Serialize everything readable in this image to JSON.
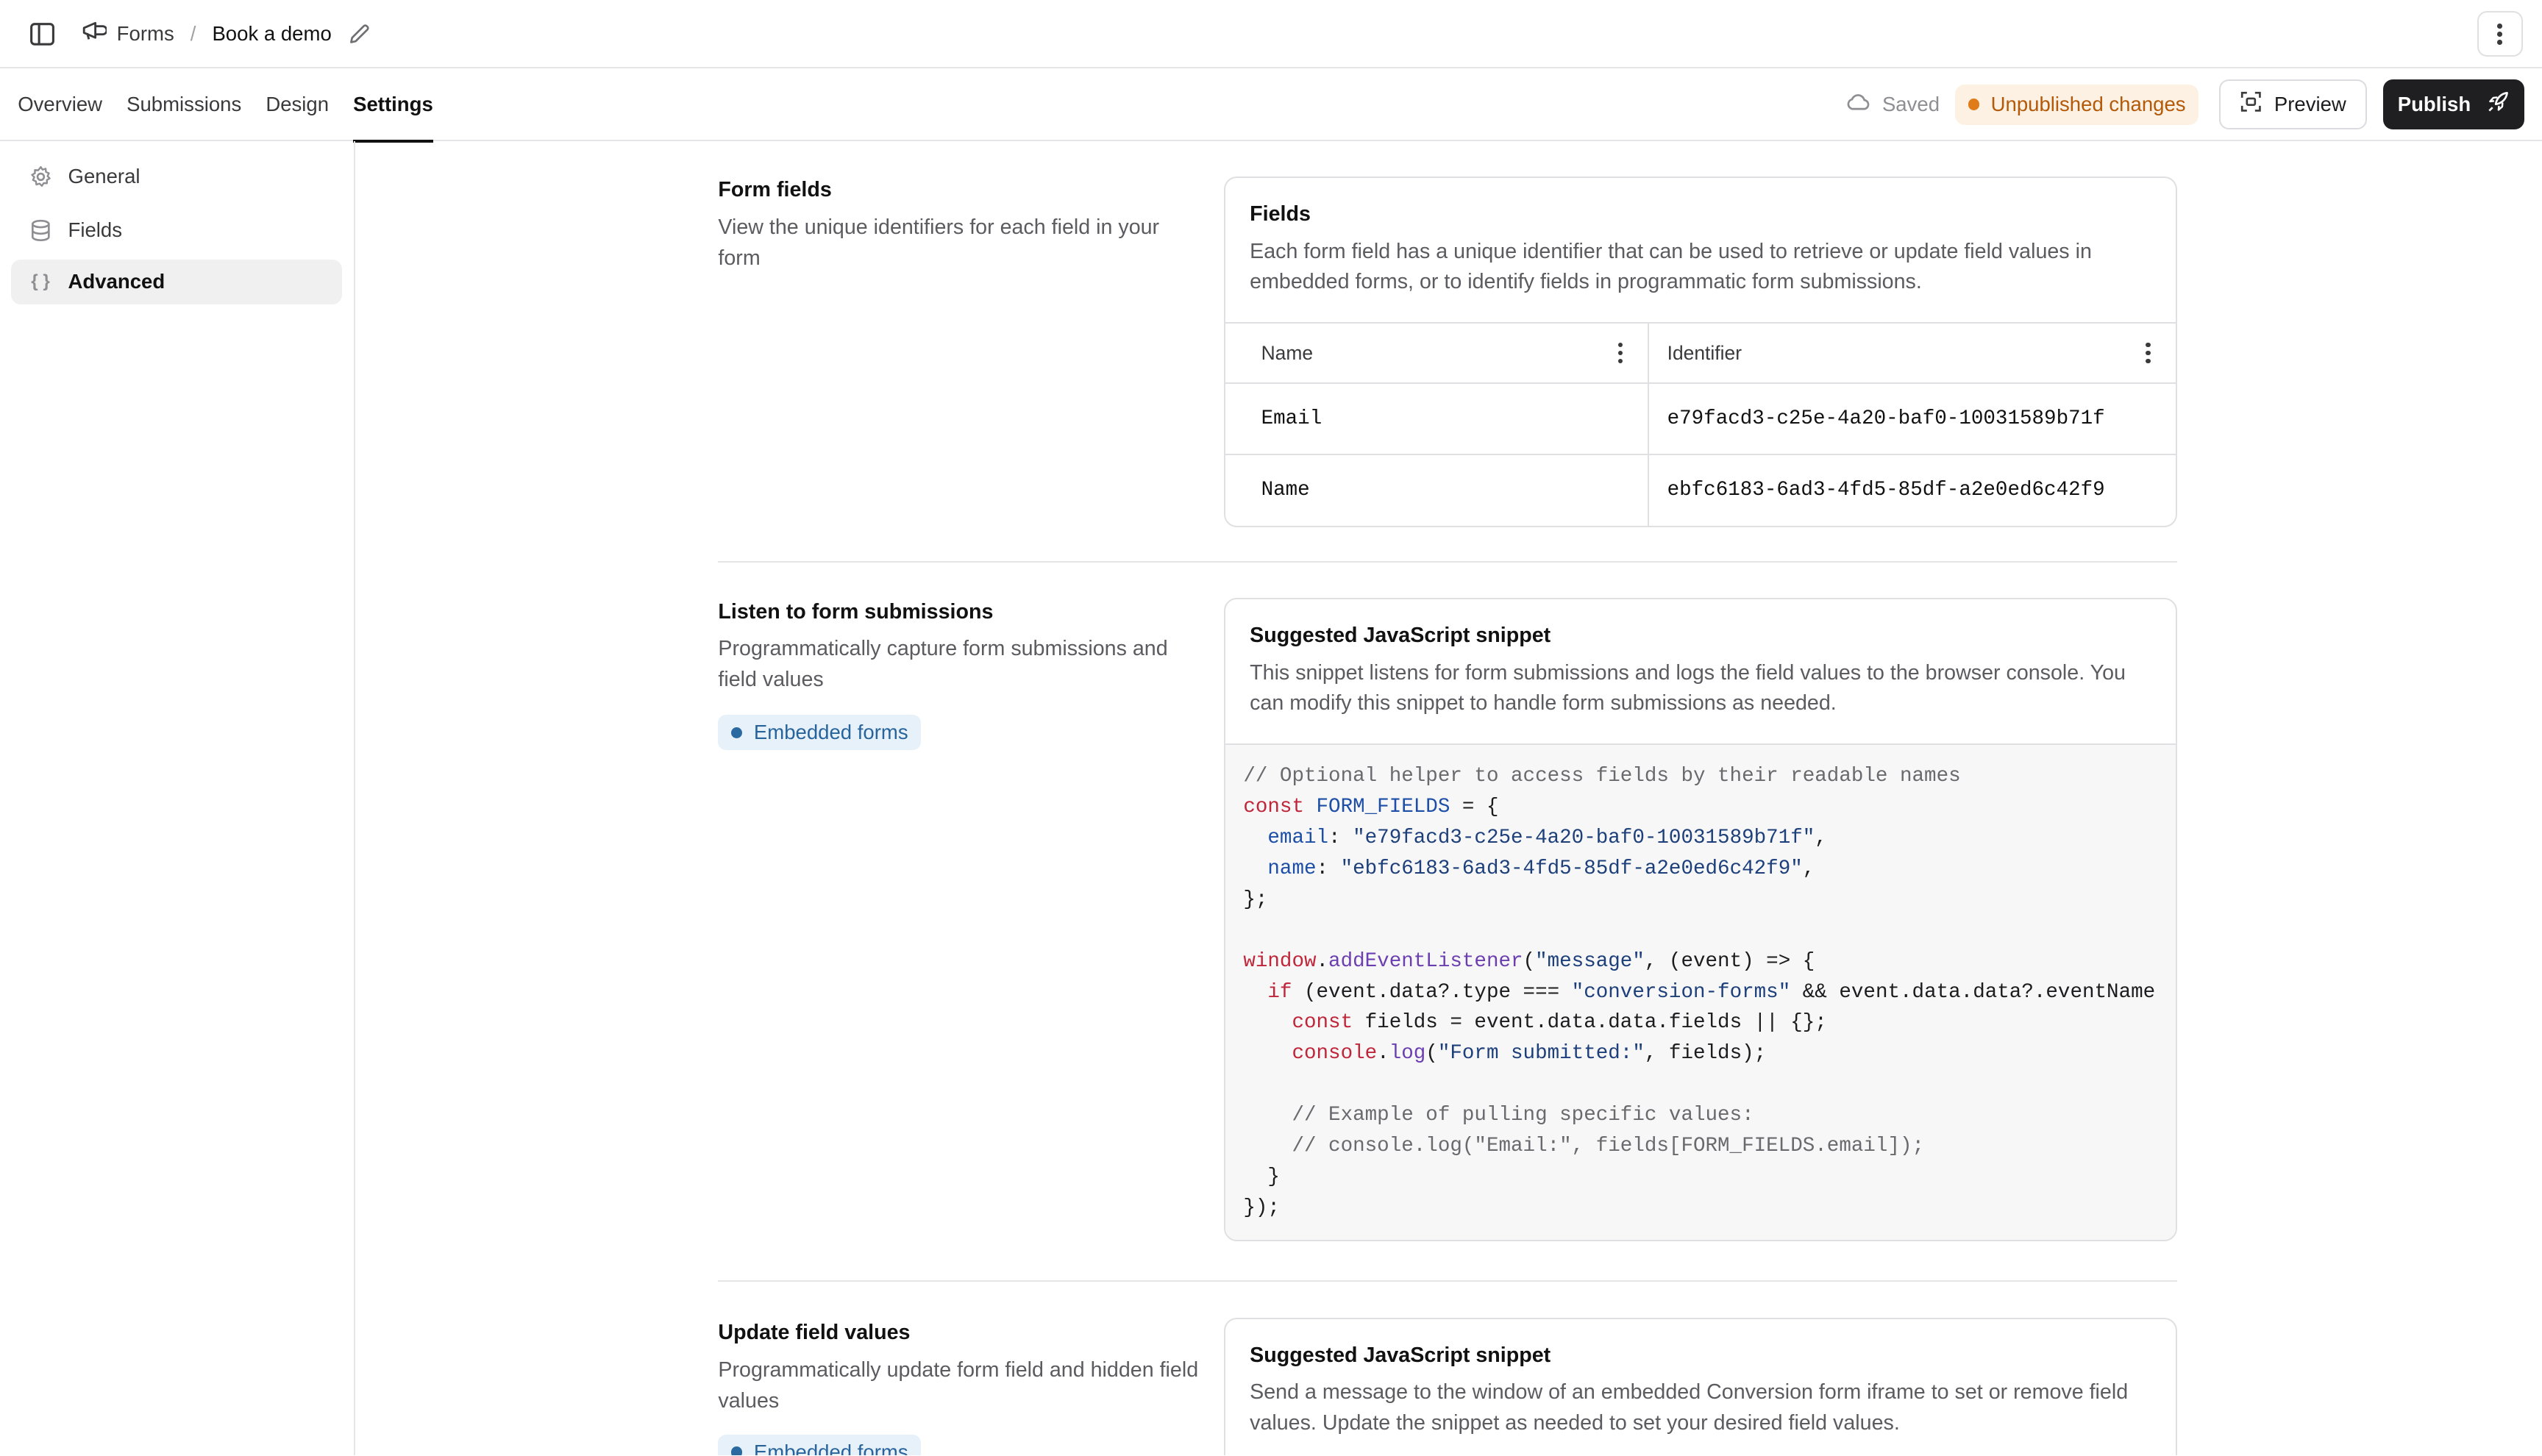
{
  "breadcrumb": {
    "root": "Forms",
    "separator": "/",
    "current": "Book a demo"
  },
  "tabs": [
    {
      "label": "Overview",
      "active": false
    },
    {
      "label": "Submissions",
      "active": false
    },
    {
      "label": "Design",
      "active": false
    },
    {
      "label": "Settings",
      "active": true
    }
  ],
  "status": {
    "saved": "Saved",
    "unpublished": "Unpublished changes"
  },
  "actions": {
    "preview": "Preview",
    "publish": "Publish"
  },
  "sidebar": {
    "items": [
      {
        "label": "General",
        "icon": "gear-icon"
      },
      {
        "label": "Fields",
        "icon": "database-icon"
      },
      {
        "label": "Advanced",
        "icon": "braces-icon",
        "active": true
      }
    ]
  },
  "sections": {
    "form_fields": {
      "title": "Form fields",
      "description": "View the unique identifiers for each field in your form",
      "card_title": "Fields",
      "card_description": "Each form field has a unique identifier that can be used to retrieve or update field values in embedded forms, or to identify fields in programmatic form submissions.",
      "columns": [
        "Name",
        "Identifier"
      ],
      "rows": [
        {
          "name": "Email",
          "identifier": "e79facd3-c25e-4a20-baf0-10031589b71f"
        },
        {
          "name": "Name",
          "identifier": "ebfc6183-6ad3-4fd5-85df-a2e0ed6c42f9"
        }
      ]
    },
    "listen": {
      "title": "Listen to form submissions",
      "description": "Programmatically capture form submissions and field values",
      "tag": "Embedded forms",
      "card_title": "Suggested JavaScript snippet",
      "card_description": "This snippet listens for form submissions and logs the field values to the browser console. You can modify this snippet to handle form submissions as needed.",
      "code": [
        "// Optional helper to access fields by their readable names",
        "const FORM_FIELDS = {",
        "  email: \"e79facd3-c25e-4a20-baf0-10031589b71f\",",
        "  name: \"ebfc6183-6ad3-4fd5-85df-a2e0ed6c42f9\",",
        "};",
        "",
        "window.addEventListener(\"message\", (event) => {",
        "  if (event.data?.type === \"conversion-forms\" && event.data.data?.eventName",
        "    const fields = event.data.data.fields || {};",
        "    console.log(\"Form submitted:\", fields);",
        "",
        "    // Example of pulling specific values:",
        "    // console.log(\"Email:\", fields[FORM_FIELDS.email]);",
        "  }",
        "});"
      ]
    },
    "update": {
      "title": "Update field values",
      "description": "Programmatically update form field and hidden field values",
      "tag": "Embedded forms",
      "card_title": "Suggested JavaScript snippet",
      "card_description": "Send a message to the window of an embedded Conversion form iframe to set or remove field values. Update the snippet as needed to set your desired field values."
    }
  },
  "colors": {
    "accent_orange": "#e07b1a",
    "tag_blue": "#2b6aa0",
    "publish_bg": "#1f1f21"
  }
}
